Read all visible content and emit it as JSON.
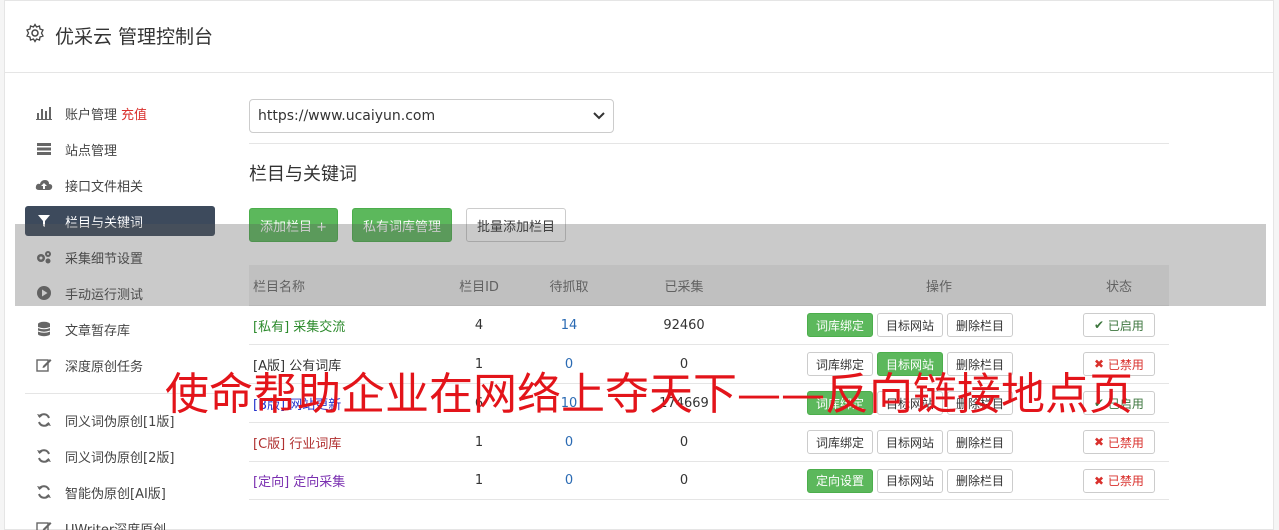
{
  "header": {
    "title": "优采云 管理控制台",
    "icon": "gear-icon"
  },
  "sidebar": {
    "items": [
      {
        "label": "账户管理",
        "extra": "充值",
        "icon": "bar-chart-icon"
      },
      {
        "label": "站点管理",
        "icon": "server-icon"
      },
      {
        "label": "接口文件相关",
        "icon": "cloud-upload-icon"
      },
      {
        "label": "栏目与关键词",
        "icon": "filter-icon",
        "active": true
      },
      {
        "label": "采集细节设置",
        "icon": "cogs-icon"
      },
      {
        "label": "手动运行测试",
        "icon": "play-circle-icon"
      },
      {
        "label": "文章暂存库",
        "icon": "database-icon"
      },
      {
        "label": "深度原创任务",
        "icon": "edit-icon"
      }
    ],
    "items2": [
      {
        "label": "同义词伪原创[1版]",
        "icon": "refresh-icon"
      },
      {
        "label": "同义词伪原创[2版]",
        "icon": "refresh-icon"
      },
      {
        "label": "智能伪原创[AI版]",
        "icon": "refresh-icon"
      },
      {
        "label": "UWriter深度原创",
        "icon": "edit-icon"
      }
    ]
  },
  "main": {
    "site_select": "https://www.ucaiyun.com",
    "section_title": "栏目与关键词",
    "buttons": {
      "add_column": "添加栏目 +",
      "private_lib": "私有词库管理",
      "batch_add": "批量添加栏目"
    }
  },
  "table": {
    "headers": [
      "栏目名称",
      "栏目ID",
      "待抓取",
      "已采集",
      "操作",
      "状态"
    ],
    "rows": [
      {
        "tag": "[私有]",
        "name": "采集交流",
        "id": "4",
        "pending": "14",
        "done": "92460",
        "op1": "词库绑定",
        "op2": "目标网站",
        "op3": "删除栏目",
        "status": "已启用"
      },
      {
        "tag": "[A版]",
        "name": "公有词库",
        "id": "1",
        "pending": "0",
        "done": "0",
        "op1": "词库绑定",
        "op2": "目标网站",
        "op3": "删除栏目",
        "status": "已禁用"
      },
      {
        "tag": "[B版]",
        "name": "网站更新",
        "id": "6",
        "pending": "10",
        "done": "174669",
        "op1": "词库绑定",
        "op2": "目标网站",
        "op3": "删除栏目",
        "status": "已启用"
      },
      {
        "tag": "[C版]",
        "name": "行业词库",
        "id": "1",
        "pending": "0",
        "done": "0",
        "op1": "词库绑定",
        "op2": "目标网站",
        "op3": "删除栏目",
        "status": "已禁用"
      },
      {
        "tag": "[定向]",
        "name": "定向采集",
        "id": "1",
        "pending": "0",
        "done": "0",
        "op1": "定向设置",
        "op2": "目标网站",
        "op3": "删除栏目",
        "status": "已禁用"
      }
    ]
  },
  "colors": {
    "private": "#2e8b2e",
    "a": "#333333",
    "b": "#2233cc",
    "c": "#b03030",
    "directed": "#7a2fb0",
    "green": "#5cb85c",
    "sidebar_active": "#3d4a5c"
  },
  "watermark": "使命帮助企业在网络上夺天下——反向链接地点页"
}
